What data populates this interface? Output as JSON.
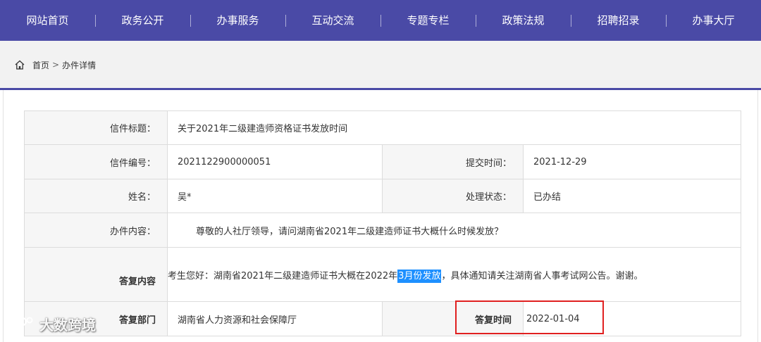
{
  "nav": {
    "items": [
      {
        "label": "网站首页"
      },
      {
        "label": "政务公开"
      },
      {
        "label": "办事服务"
      },
      {
        "label": "互动交流"
      },
      {
        "label": "专题专栏"
      },
      {
        "label": "政策法规"
      },
      {
        "label": "招聘招录"
      },
      {
        "label": "办事大厅"
      }
    ]
  },
  "breadcrumb": {
    "home": "首页",
    "separator": ">",
    "current": "办件详情"
  },
  "detail": {
    "title_label": "信件标题：",
    "title_value": "关于2021年二级建造师资格证书发放时间",
    "number_label": "信件编号：",
    "number_value": "2021122900000051",
    "submit_time_label": "提交时间：",
    "submit_time_value": "2021-12-29",
    "name_label": "姓名：",
    "name_value": "吴*",
    "status_label": "处理状态：",
    "status_value": "已办结",
    "content_label": "办件内容：",
    "content_value": "尊敬的人社厅领导，请问湖南省2021年二级建造师证书大概什么时候发放？",
    "reply_label": "答复内容",
    "reply_before": "考生您好：湖南省2021年二级建造师证书大概在2022年",
    "reply_highlight": "3月份发放",
    "reply_after": "，具体通知请关注湖南省人事考试网公告。谢谢。",
    "dept_label": "答复部门",
    "dept_value": "湖南省人力资源和社会保障厅",
    "reply_time_label": "答复时间",
    "reply_time_value": "2022-01-04"
  },
  "watermark": {
    "text": "大数跨境"
  },
  "colors": {
    "nav_bg": "#4a4aa6",
    "highlight": "#1e90ff",
    "annotation": "#e02020"
  }
}
